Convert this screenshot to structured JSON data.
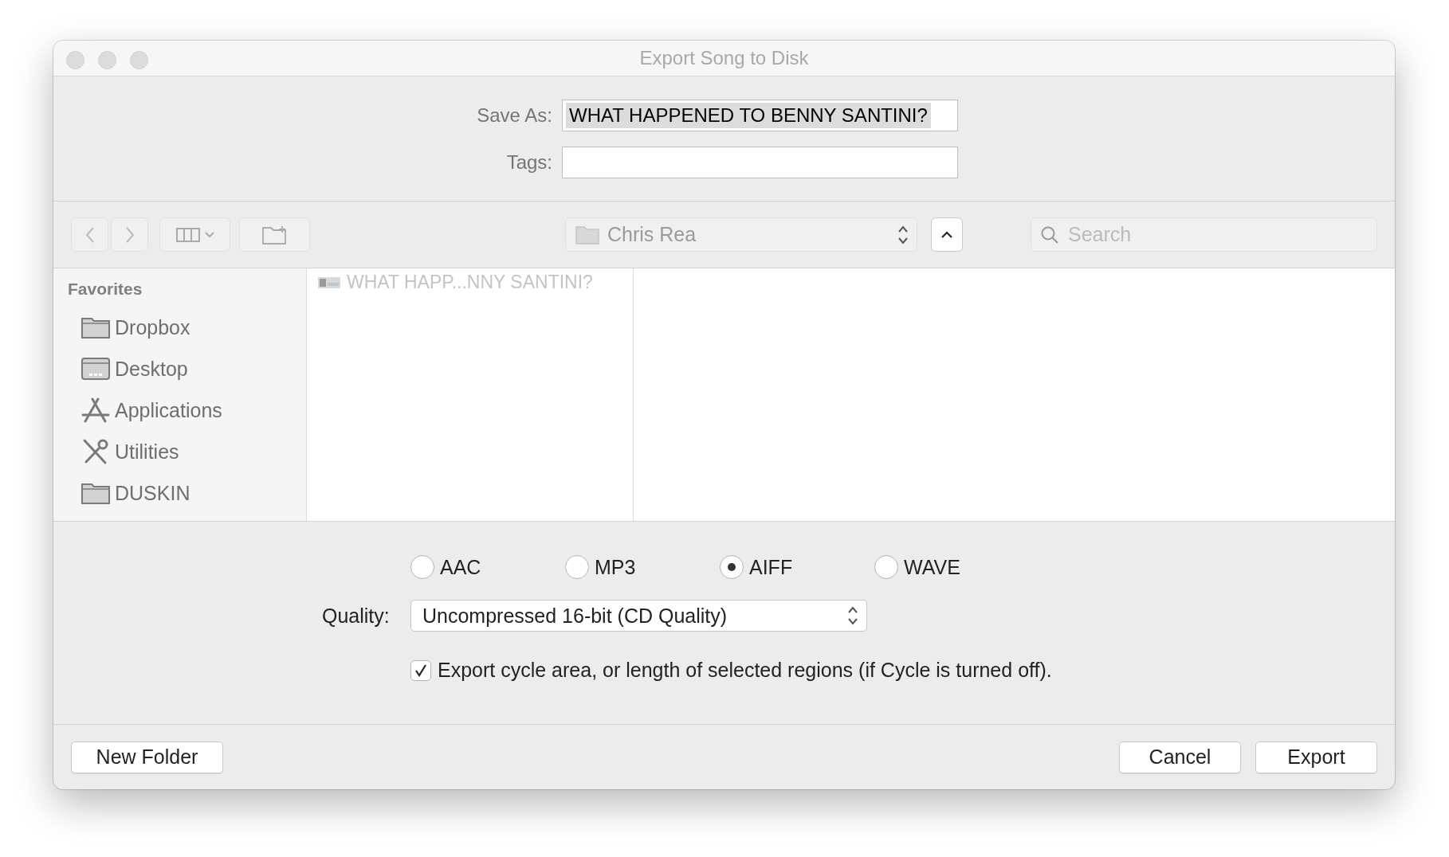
{
  "window": {
    "title": "Export Song to Disk"
  },
  "save_as": {
    "label": "Save As:",
    "value": "WHAT HAPPENED TO BENNY SANTINI?",
    "selected": true
  },
  "tags": {
    "label": "Tags:"
  },
  "toolbar": {
    "location": "Chris Rea",
    "search": {
      "placeholder": "Search"
    }
  },
  "sidebar": {
    "heading": "Favorites",
    "items": [
      {
        "label": "Dropbox",
        "kind": "folder"
      },
      {
        "label": "Desktop",
        "kind": "desktop"
      },
      {
        "label": "Applications",
        "kind": "applications"
      },
      {
        "label": "Utilities",
        "kind": "utilities"
      },
      {
        "label": "DUSKIN",
        "kind": "folder"
      }
    ]
  },
  "files": [
    {
      "name": "WHAT HAPP...NNY SANTINI?",
      "disabled": true
    }
  ],
  "formats": [
    {
      "label": "AAC",
      "selected": false
    },
    {
      "label": "MP3",
      "selected": false
    },
    {
      "label": "AIFF",
      "selected": true
    },
    {
      "label": "WAVE",
      "selected": false
    }
  ],
  "quality": {
    "label": "Quality:",
    "value": "Uncompressed 16-bit (CD Quality)"
  },
  "cycle_option": {
    "label": "Export cycle area, or length of selected regions (if Cycle is turned off).",
    "checked": true
  },
  "buttons": {
    "new_folder": "New Folder",
    "cancel": "Cancel",
    "export": "Export"
  }
}
